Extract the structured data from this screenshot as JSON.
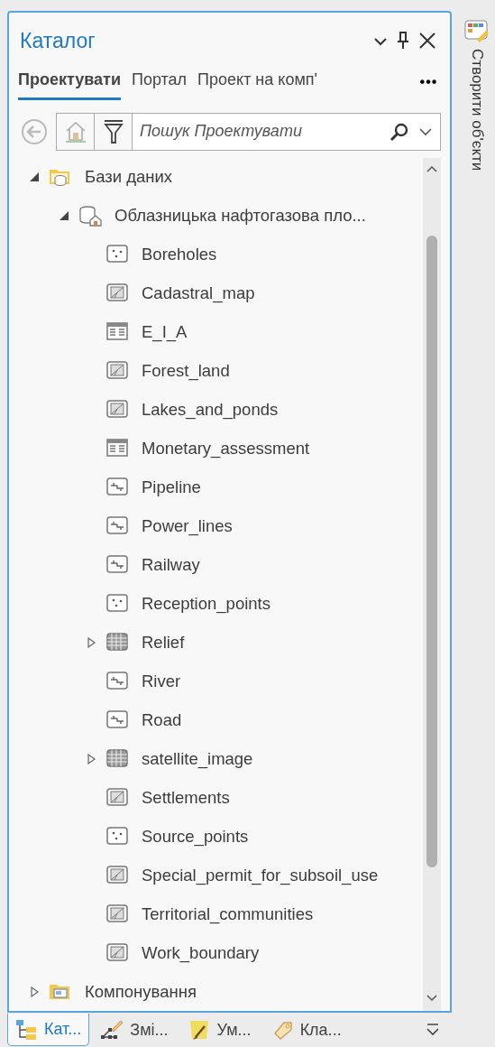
{
  "pane": {
    "title": "Каталог"
  },
  "tabs": [
    {
      "label": "Проектувати",
      "selected": true
    },
    {
      "label": "Портал",
      "selected": false
    },
    {
      "label": "Проект на комп'",
      "selected": false
    }
  ],
  "more_tabs": "•••",
  "search": {
    "placeholder": "Пошук Проектувати",
    "back_disabled": true
  },
  "tree": [
    {
      "label": "Бази даних",
      "kind": "database-folder",
      "expanded": true,
      "children": [
        {
          "label": "Облазницька нафтогазова пло...",
          "kind": "geodatabase",
          "expanded": true,
          "children": [
            {
              "label": "Boreholes",
              "kind": "point"
            },
            {
              "label": "Cadastral_map",
              "kind": "polygon"
            },
            {
              "label": "E_I_A",
              "kind": "table"
            },
            {
              "label": "Forest_land",
              "kind": "polygon"
            },
            {
              "label": "Lakes_and_ponds",
              "kind": "polygon"
            },
            {
              "label": "Monetary_assessment",
              "kind": "table"
            },
            {
              "label": "Pipeline",
              "kind": "line"
            },
            {
              "label": "Power_lines",
              "kind": "line"
            },
            {
              "label": "Railway",
              "kind": "line"
            },
            {
              "label": "Reception_points",
              "kind": "point"
            },
            {
              "label": "Relief",
              "kind": "raster",
              "expanded": false
            },
            {
              "label": "River",
              "kind": "line"
            },
            {
              "label": "Road",
              "kind": "line"
            },
            {
              "label": "satellite_image",
              "kind": "raster",
              "expanded": false
            },
            {
              "label": "Settlements",
              "kind": "polygon"
            },
            {
              "label": "Source_points",
              "kind": "point"
            },
            {
              "label": "Special_permit_for_subsoil_use",
              "kind": "polygon"
            },
            {
              "label": "Territorial_communities",
              "kind": "polygon"
            },
            {
              "label": "Work_boundary",
              "kind": "polygon"
            }
          ]
        }
      ]
    },
    {
      "label": "Компонування",
      "kind": "layout-folder",
      "expanded": false
    }
  ],
  "bottom_tabs": [
    {
      "label": "Кат...",
      "kind": "catalog",
      "selected": true
    },
    {
      "label": "Змі...",
      "kind": "edit",
      "selected": false
    },
    {
      "label": "Ум...",
      "kind": "symbol",
      "selected": false
    },
    {
      "label": "Кла...",
      "kind": "tag",
      "selected": false
    }
  ],
  "side_panel": {
    "label": "Створити об'єкти"
  }
}
